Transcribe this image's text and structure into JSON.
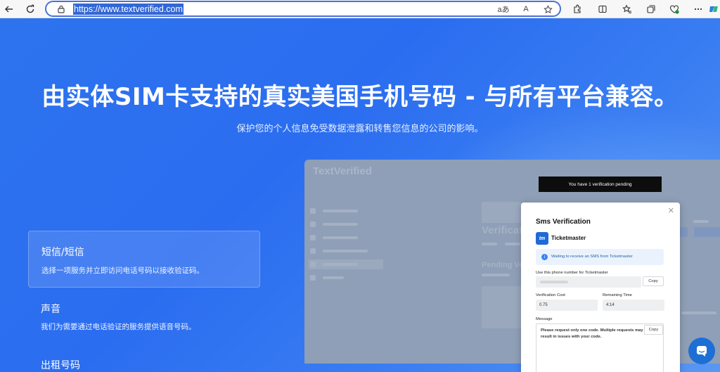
{
  "browser": {
    "url": "https://www.textverified.com",
    "translate_label": "aあ",
    "read_aloud_label": "A"
  },
  "hero": {
    "headline": "由实体SIM卡支持的真实美国手机号码 - 与所有平台兼容。",
    "subheadline": "保护您的个人信息免受数据泄露和转售您信息的公司的影响。"
  },
  "features": [
    {
      "title": "短信/短信",
      "desc": "选择一项服务并立即访问电话号码以接收验证码。"
    },
    {
      "title": "声音",
      "desc": "我们为需要通过电话验证的服务提供语音号码。"
    },
    {
      "title": "出租号码",
      "desc": ""
    }
  ],
  "preview": {
    "logo": "TextVerified",
    "page_title": "Verificati",
    "pending_section": "Pending Veri",
    "pending_banner": "You have 1 verification pending"
  },
  "modal": {
    "title": "Sms Verification",
    "service_logo": "tm",
    "service": "Ticketmaster",
    "info": "Waiting to receive an SMS from Ticketmaster",
    "phone_label": "Use this phone number for Ticketmaster",
    "copy_label": "Copy",
    "cost_label": "Verification Cost",
    "cost_value": "0.75",
    "time_label": "Remaining Time",
    "time_value": "4:14",
    "message_label": "Message",
    "message_text": "Please request only one code. Multiple requests may result in issues with your code."
  },
  "colors": {
    "hero_blue": "#2d73ee",
    "accent": "#3367d6",
    "chat": "#1d6fd6"
  }
}
